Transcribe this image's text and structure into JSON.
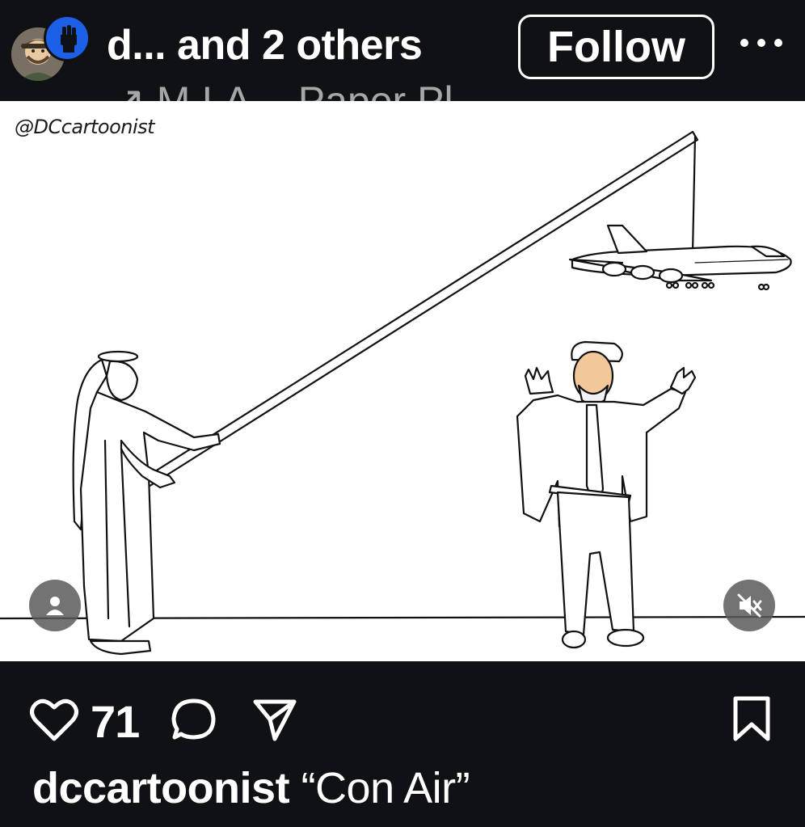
{
  "header": {
    "author_line": "d... and 2 others",
    "music_line": "↗ M.I.A. · Paper Pl...",
    "follow_label": "Follow",
    "avatar_icon": "profile-avatar",
    "story_badge_icon": "raised-fist-icon"
  },
  "media": {
    "watermark": "@DCcartoonist",
    "tag_icon": "person-icon",
    "mute_icon": "speaker-muted-icon"
  },
  "actions": {
    "like_count": "71",
    "like_icon": "heart-icon",
    "comment_icon": "comment-icon",
    "share_icon": "send-icon",
    "save_icon": "bookmark-icon"
  },
  "caption": {
    "username": "dccartoonist",
    "text": "“Con Air”"
  },
  "colors": {
    "background": "#0f1115",
    "badge_blue": "#1d60e8",
    "overlay_gray": "#5a5a5a"
  }
}
